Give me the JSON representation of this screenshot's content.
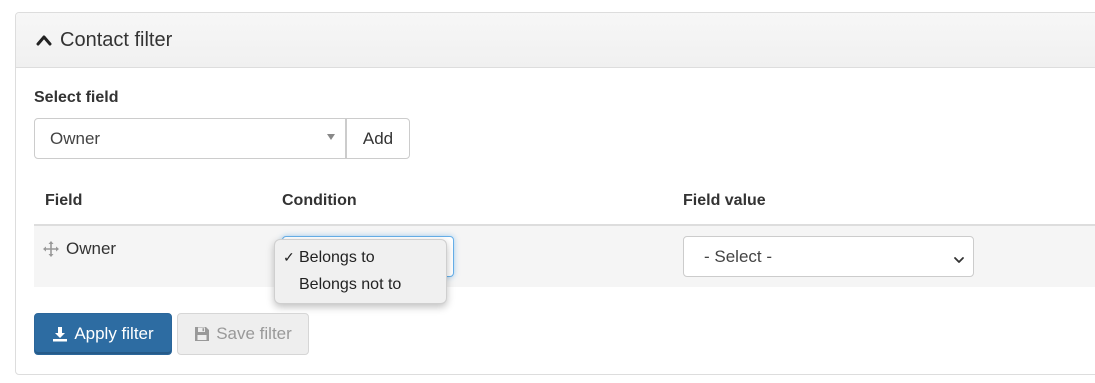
{
  "panel": {
    "title": "Contact filter"
  },
  "select_field": {
    "label": "Select field",
    "value": "Owner",
    "add_label": "Add"
  },
  "table": {
    "headers": {
      "field": "Field",
      "condition": "Condition",
      "field_value": "Field value"
    },
    "rows": [
      {
        "field": "Owner",
        "condition": "Belongs to",
        "field_value": "- Select -"
      }
    ]
  },
  "condition_dropdown": {
    "options": [
      "Belongs to",
      "Belongs not to"
    ],
    "selected_mark": "✓"
  },
  "buttons": {
    "apply_label": "Apply filter",
    "save_label": "Save filter"
  },
  "colors": {
    "primary": "#2d6ca2",
    "focus": "#66afe9"
  }
}
